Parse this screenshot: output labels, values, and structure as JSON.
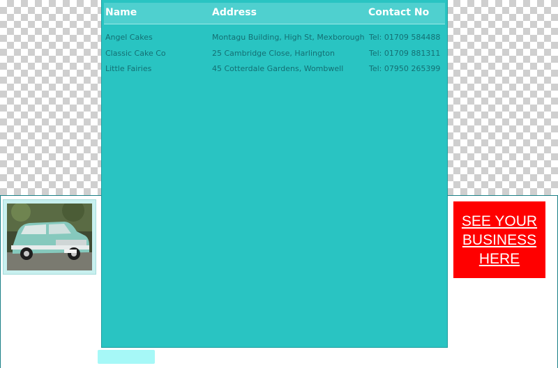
{
  "table": {
    "headers": {
      "name": "Name",
      "address": "Address",
      "contact": "Contact No"
    },
    "rows": [
      {
        "name": "Angel Cakes",
        "address": "Montagu Building, High St, Mexborough",
        "contact": "Tel: 01709 584488"
      },
      {
        "name": "Classic Cake Co",
        "address": "25 Cambridge Close, Harlington",
        "contact": "Tel: 01709 881311"
      },
      {
        "name": "Little Fairies",
        "address": "45 Cotterdale Gardens, Wombwell",
        "contact": "Tel: 07950 265399"
      }
    ]
  },
  "advert": {
    "lines": [
      "SEE YOUR",
      "BUSINESS",
      "HERE"
    ]
  },
  "colors": {
    "panel": "#29c4c2",
    "header": "#4fd0cf",
    "advert": "#ff0000",
    "text": "#136f73"
  }
}
